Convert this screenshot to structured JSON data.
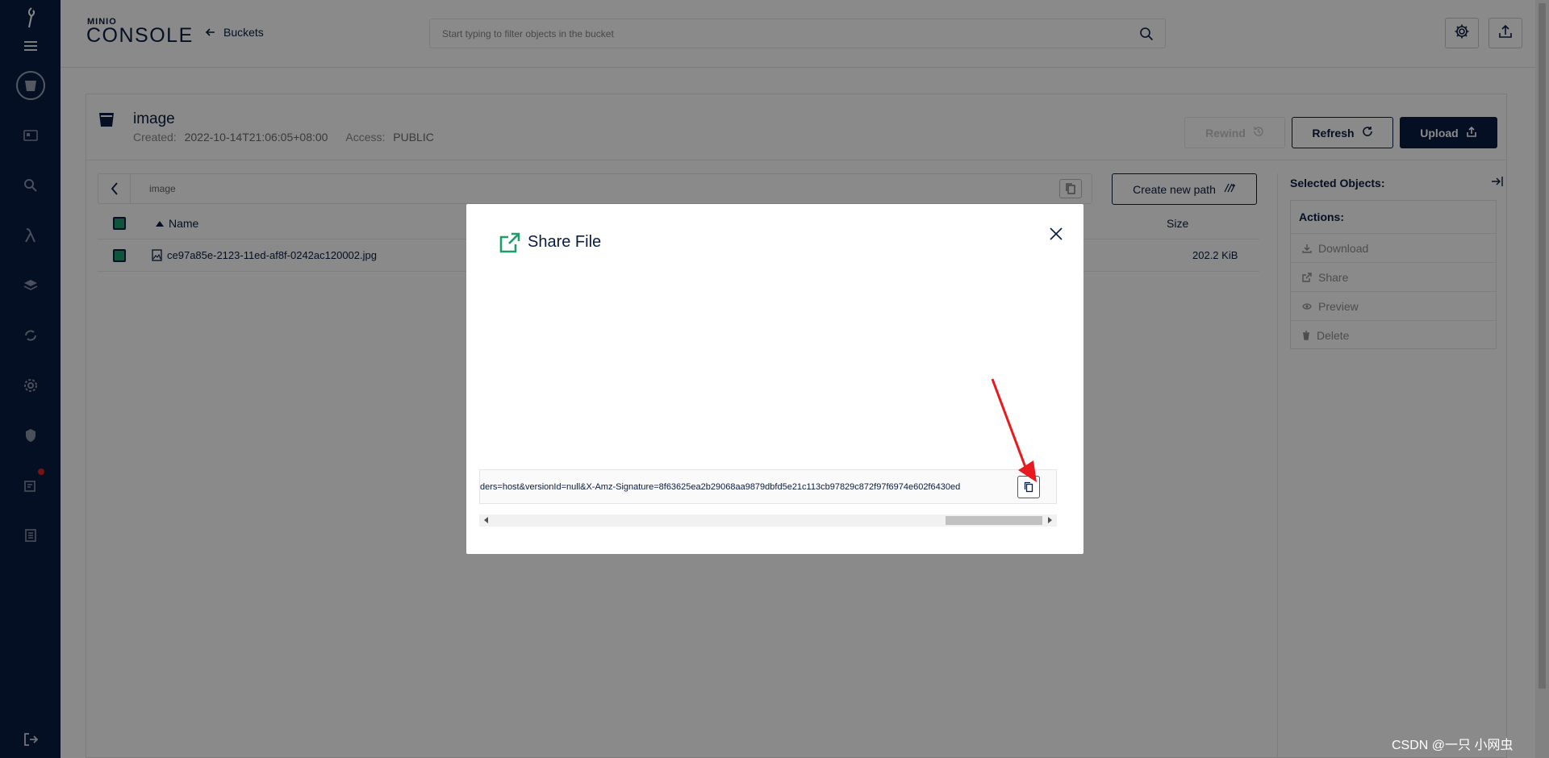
{
  "header": {
    "logo_top": "MINIO",
    "logo_bottom": "CONSOLE",
    "back_label": "Buckets",
    "search_placeholder": "Start typing to filter objects in the bucket"
  },
  "bucket": {
    "name": "image",
    "created_label": "Created:",
    "created_value": "2022-10-14T21:06:05+08:00",
    "access_label": "Access:",
    "access_value": "PUBLIC",
    "rewind_label": "Rewind",
    "refresh_label": "Refresh",
    "upload_label": "Upload"
  },
  "browser": {
    "breadcrumb": "image",
    "create_path_label": "Create new path",
    "columns": {
      "name": "Name",
      "size": "Size"
    },
    "rows": [
      {
        "name": "ce97a85e-2123-11ed-af8f-0242ac120002.jpg",
        "size": "202.2 KiB"
      }
    ]
  },
  "selected_panel": {
    "title": "Selected Objects:",
    "actions_label": "Actions:",
    "actions": [
      "Download",
      "Share",
      "Preview",
      "Delete"
    ]
  },
  "modal": {
    "title": "Share File",
    "url": "ders=host&versionId=null&X-Amz-Signature=8f63625ea2b29068aa9879dbfd5e21c113cb97829c872f97f6974e602f6430ed"
  },
  "watermark": "CSDN @一只 小网虫",
  "colors": {
    "navy": "#081c42",
    "accent_green": "#1e9e6a",
    "annotation_red": "#e8191f"
  }
}
